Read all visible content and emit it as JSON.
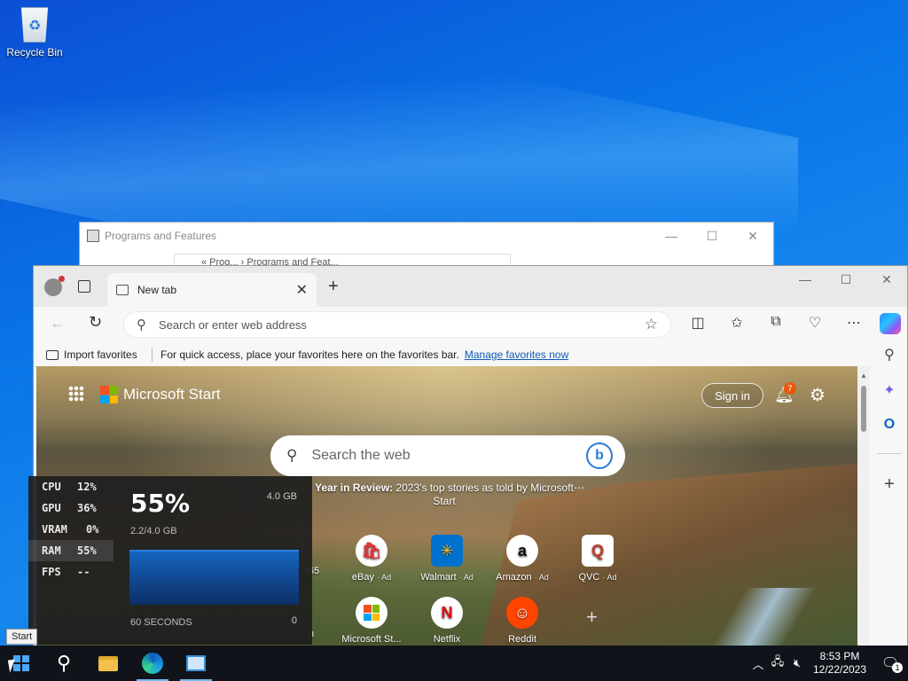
{
  "desktop": {
    "icons": [
      {
        "label": "Recycle Bin",
        "icon": "recycle-bin-icon"
      }
    ]
  },
  "programs_window": {
    "title": "Programs and Features",
    "address": "« Prog... › Programs and Feat..."
  },
  "edge": {
    "tab": {
      "title": "New tab"
    },
    "address_placeholder": "Search or enter web address",
    "favorites_bar": {
      "import_label": "Import favorites",
      "message": "For quick access, place your favorites here on the favorites bar.",
      "link": "Manage favorites now"
    },
    "start_page": {
      "brand": "Microsoft Start",
      "sign_in": "Sign in",
      "notification_count": "7",
      "search_placeholder": "Search the web",
      "headline_bold": "Year in Review:",
      "headline_text": " 2023's top stories as told by Microsoft Start",
      "more_glyph": "⋯",
      "partial_tile_label": "365",
      "tiles": [
        {
          "label": "eBay",
          "ad": "· Ad",
          "icon": "ebay-icon"
        },
        {
          "label": "Walmart",
          "ad": "· Ad",
          "icon": "walmart-icon"
        },
        {
          "label": "Amazon",
          "ad": "· Ad",
          "icon": "amazon-icon"
        },
        {
          "label": "QVC",
          "ad": "· Ad",
          "icon": "qvc-icon"
        },
        {
          "label": "Microsoft St...",
          "ad": "",
          "icon": "microsoft-store-icon"
        },
        {
          "label": "Netflix",
          "ad": "",
          "icon": "netflix-icon"
        },
        {
          "label": "Reddit",
          "ad": "",
          "icon": "reddit-icon"
        }
      ],
      "partial_tile_label_2": "n"
    }
  },
  "perf_overlay": {
    "rows": [
      {
        "label": "CPU",
        "value": "12%"
      },
      {
        "label": "GPU",
        "value": "36%"
      },
      {
        "label": "VRAM",
        "value": "0%"
      },
      {
        "label": "RAM",
        "value": "55%"
      },
      {
        "label": "FPS",
        "value": "--"
      }
    ],
    "big_value": "55%",
    "total": "4.0 GB",
    "used": "2.2/4.0 GB",
    "seconds_label": "60 SECONDS",
    "zero_label": "0"
  },
  "tooltip": {
    "text": "Start"
  },
  "taskbar": {
    "clock_time": "8:53 PM",
    "clock_date": "12/22/2023",
    "notif_count": "1"
  },
  "colors": {
    "accent": "#0f5bb5",
    "taskbar": "#10131a",
    "perf_graph": "#1565c0"
  }
}
